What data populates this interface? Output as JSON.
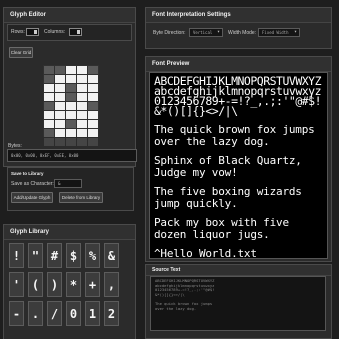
{
  "glyph_editor": {
    "title": "Glyph Editor",
    "rows_label": "Rows:",
    "columns_label": "Columns:",
    "clear_label": "Clear Grid",
    "bytes_label": "Bytes:",
    "bytes_value": "0x00, 0x00, 0xEF, 0xEE, 0x00"
  },
  "library_save": {
    "title": "Save to Library",
    "save_as_label": "Save as Character:",
    "char_value": "&",
    "add_label": "Add/Update Glyph",
    "delete_label": "Delete from Library"
  },
  "interpretation": {
    "title": "Font Interpretation Settings",
    "byte_direction_label": "Byte Direction:",
    "byte_direction_value": "Vertical",
    "width_mode_label": "Width Mode:",
    "width_mode_value": "Fixed Width"
  },
  "font_preview": {
    "title": "Font Preview",
    "charset": [
      "ABCDEFGHIJKLMNOPQRSTUVWXYZ",
      "abcdefghijklmnopqrstuvwxyz",
      "0123456789+-=!?_,.;:'\"@#$!",
      "&*()[]{}<>/|\\"
    ],
    "pangrams": [
      "The quick brown fox jumps over the lazy dog.",
      "Sphinx of Black Quartz, Judge my vow!",
      "The five boxing wizards jump quickly.",
      "Pack my box with five dozen liquor jugs.",
      "^Hello_World.txt"
    ]
  },
  "source_text": {
    "title": "Source Text",
    "value": "ABCDEFGHIJKLMNOPQRSTUVWXYZ\nabcdefghijklmnopqrstuvwxyz\n0123456789+-=!?_,.;:'\"@#$!\n&*()[]{}<>/|\\\n\nThe quick brown fox jumps\nover the lazy dog."
  },
  "glyph_library": {
    "title": "Glyph Library",
    "glyphs": [
      "!",
      "\"",
      "#",
      "$",
      "%",
      "&",
      "'",
      "(",
      ")",
      "*",
      "+",
      ",",
      "-",
      ".",
      "/",
      "0",
      "1",
      "2"
    ]
  }
}
